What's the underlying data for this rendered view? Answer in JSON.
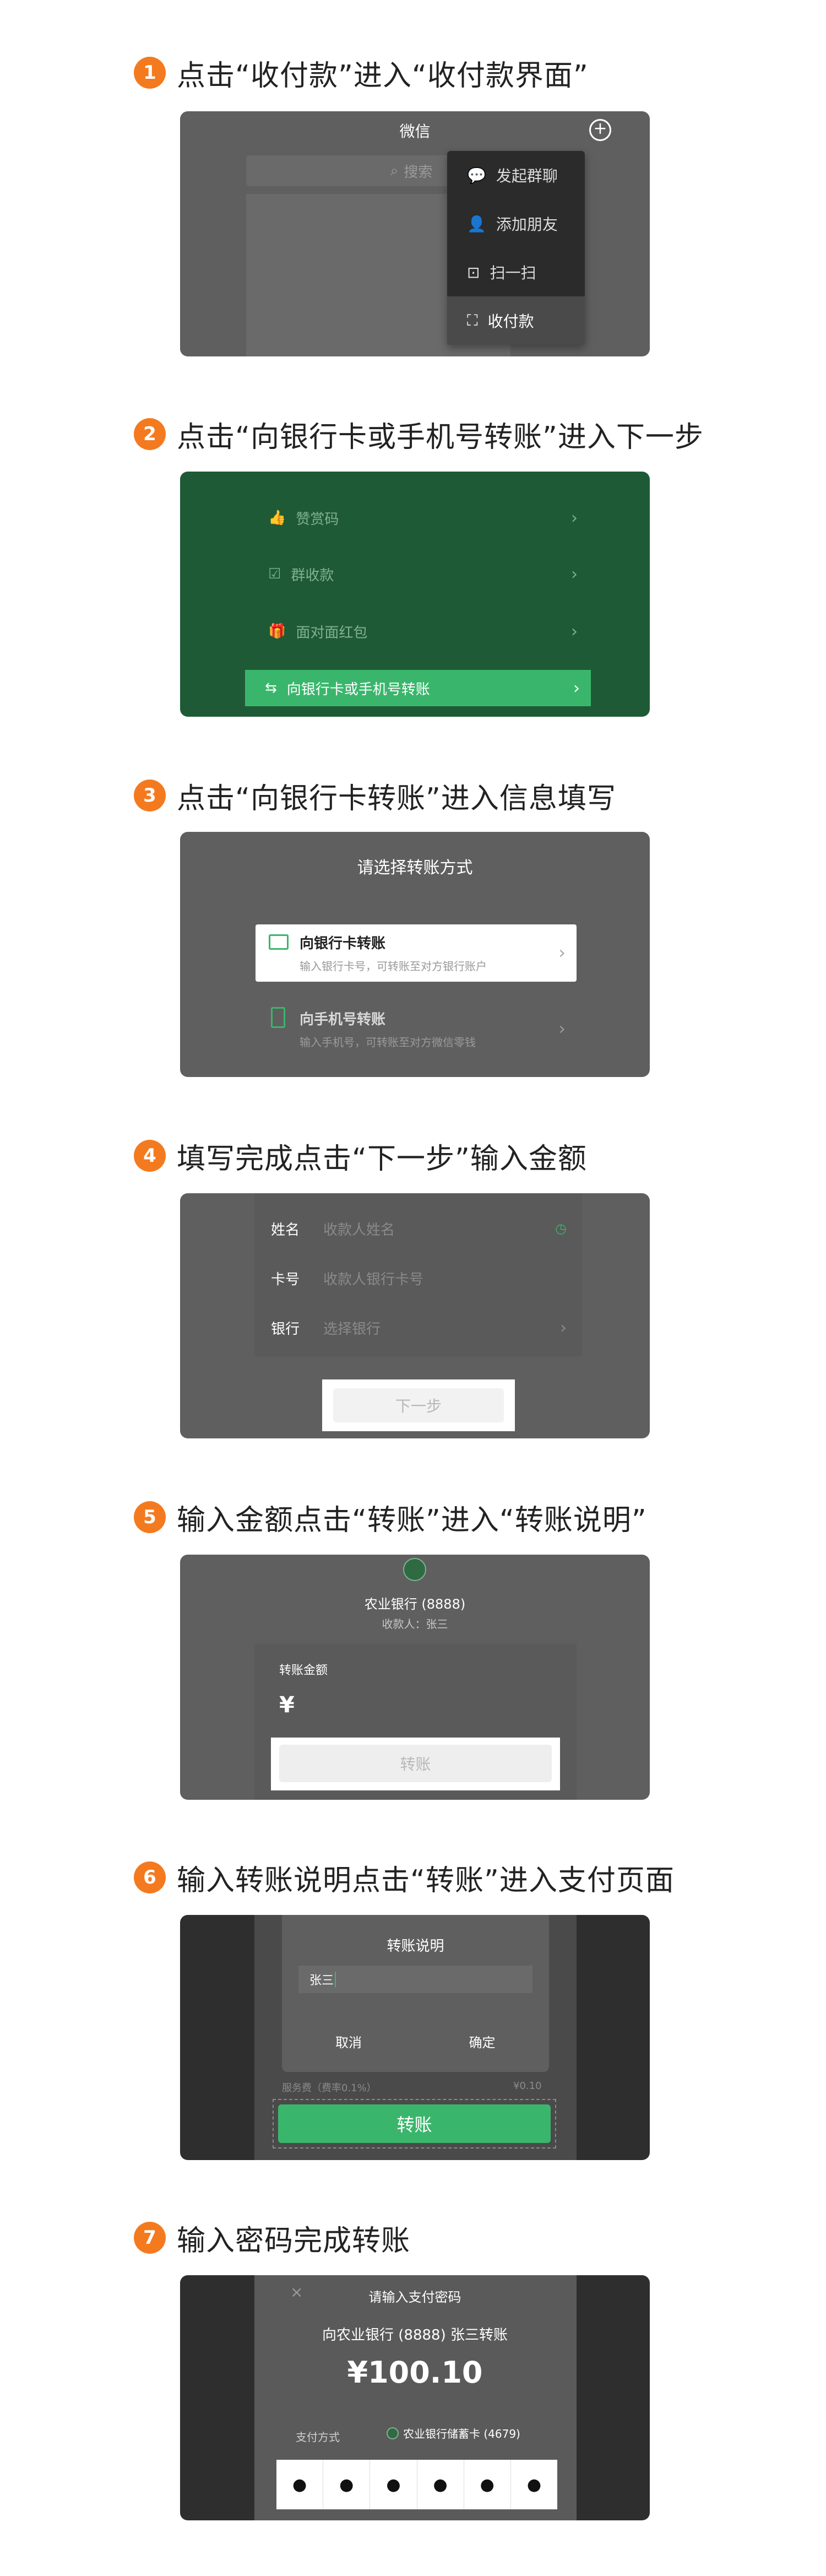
{
  "steps": [
    {
      "num": "1",
      "title": "点击“收付款”进入“收付款界面”"
    },
    {
      "num": "2",
      "title": "点击“向银行卡或手机号转账”进入下一步"
    },
    {
      "num": "3",
      "title": "点击“向银行卡转账”进入信息填写"
    },
    {
      "num": "4",
      "title": "填写完成点击“下一步”输入金额"
    },
    {
      "num": "5",
      "title": "输入金额点击“转账”进入“转账说明”"
    },
    {
      "num": "6",
      "title": "输入转账说明点击“转账”进入支付页面"
    },
    {
      "num": "7",
      "title": "输入密码完成转账"
    }
  ],
  "s1": {
    "title": "微信",
    "search_placeholder": "搜索",
    "menu": [
      {
        "label": "发起群聊",
        "icon": "chat-bubble-icon"
      },
      {
        "label": "添加朋友",
        "icon": "add-friend-icon"
      },
      {
        "label": "扫一扫",
        "icon": "scan-icon"
      },
      {
        "label": "收付款",
        "icon": "payment-icon"
      }
    ]
  },
  "s2": {
    "rows": [
      {
        "label": "赞赏码",
        "icon": "thumb-icon"
      },
      {
        "label": "群收款",
        "icon": "group-collect-icon"
      },
      {
        "label": "面对面红包",
        "icon": "red-packet-icon"
      }
    ],
    "highlight": "向银行卡或手机号转账"
  },
  "s3": {
    "title": "请选择转账方式",
    "opt1_title": "向银行卡转账",
    "opt1_sub": "输入银行卡号，可转账至对方银行账户",
    "opt2_title": "向手机号转账",
    "opt2_sub": "输入手机号，可转账至对方微信零钱"
  },
  "s4": {
    "rows": [
      {
        "label": "姓名",
        "placeholder": "收款人姓名"
      },
      {
        "label": "卡号",
        "placeholder": "收款人银行卡号"
      },
      {
        "label": "银行",
        "placeholder": "选择银行"
      }
    ],
    "next": "下一步"
  },
  "s5": {
    "bank": "农业银行 (8888)",
    "payee": "收款人：张三",
    "amount_label": "转账金额",
    "currency": "¥",
    "button": "转账"
  },
  "s6": {
    "dialog_title": "转账说明",
    "input_value": "张三",
    "cancel": "取消",
    "confirm": "确定",
    "fee_left": "服务费（费率0.1%）",
    "fee_right": "¥0.10",
    "button": "转账"
  },
  "s7": {
    "close": "×",
    "title": "请输入支付密码",
    "to": "向农业银行 (8888) 张三转账",
    "amount": "¥100.10",
    "pay_label": "支付方式",
    "pay_value": "农业银行储蓄卡 (4679)",
    "dots": [
      "●",
      "●",
      "●",
      "●",
      "●",
      "●"
    ]
  },
  "colors": {
    "orange": "#f47a1f",
    "wechat_green": "#3ab66c"
  }
}
